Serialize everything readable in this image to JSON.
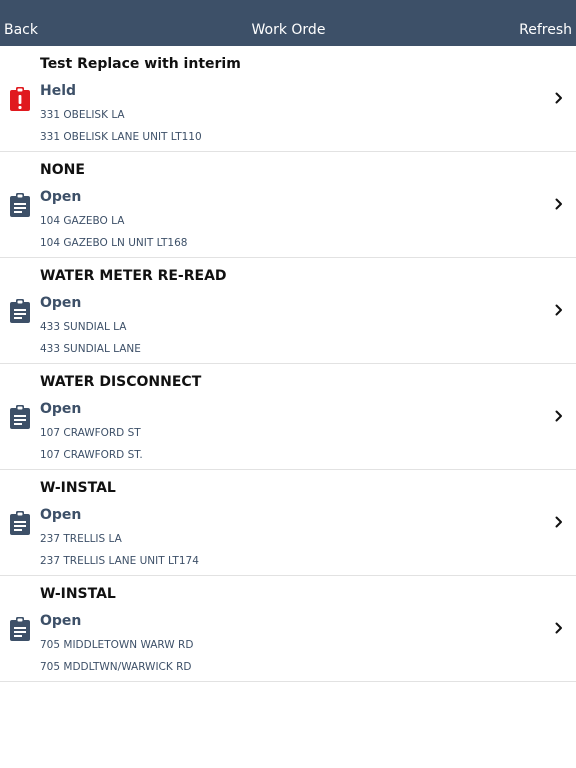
{
  "navbar": {
    "back_label": "Back",
    "title": "Work Orders",
    "refresh_label": "Refresh",
    "background": "#3d5068"
  },
  "colors": {
    "status_text": "#3d5068",
    "held_icon": "#e0191e",
    "open_icon": "#3d5068"
  },
  "work_orders": [
    {
      "title": "Test Replace with interim",
      "status": "Held",
      "icon": "alert-clipboard-icon",
      "address_short": "331 OBELISK LA",
      "address_full": "331 OBELISK LANE UNIT LT110"
    },
    {
      "title": "NONE",
      "status": "Open",
      "icon": "clipboard-icon",
      "address_short": "104 GAZEBO LA",
      "address_full": "104 GAZEBO LN UNIT LT168"
    },
    {
      "title": "WATER METER RE-READ",
      "status": "Open",
      "icon": "clipboard-icon",
      "address_short": "433 SUNDIAL LA",
      "address_full": "433 SUNDIAL LANE"
    },
    {
      "title": "WATER DISCONNECT",
      "status": "Open",
      "icon": "clipboard-icon",
      "address_short": "107 CRAWFORD ST",
      "address_full": "107 CRAWFORD ST."
    },
    {
      "title": "W-INSTAL",
      "status": "Open",
      "icon": "clipboard-icon",
      "address_short": "237 TRELLIS LA",
      "address_full": "237 TRELLIS LANE UNIT LT174"
    },
    {
      "title": "W-INSTAL",
      "status": "Open",
      "icon": "clipboard-icon",
      "address_short": "705 MIDDLETOWN WARW RD",
      "address_full": "705 MDDLTWN/WARWICK RD"
    }
  ]
}
